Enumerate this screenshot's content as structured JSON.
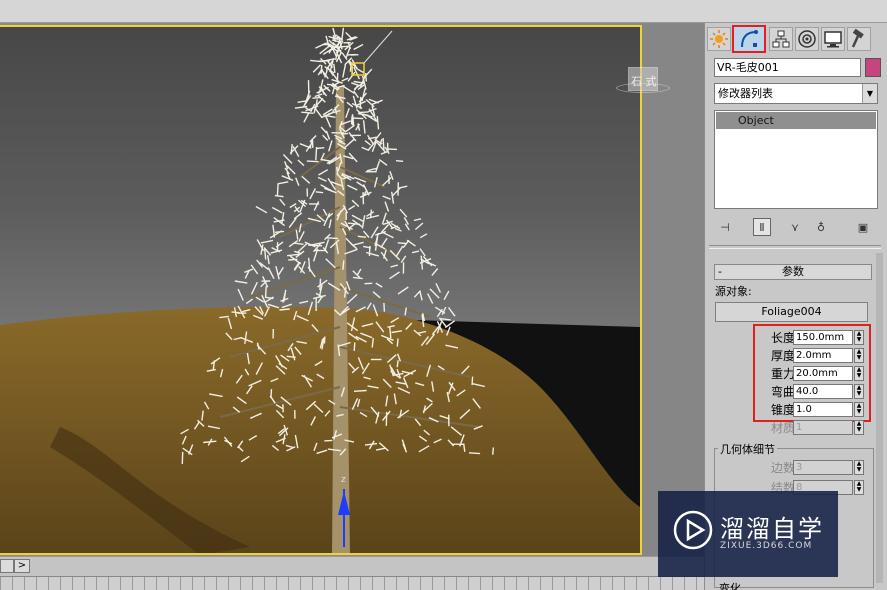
{
  "viewport": {
    "label": "石 式"
  },
  "panel": {
    "tabs": [
      {
        "name": "create-tab",
        "icon": "sun-icon"
      },
      {
        "name": "modify-tab",
        "icon": "modify-curve-icon",
        "active": true
      },
      {
        "name": "hierarchy-tab",
        "icon": "hierarchy-icon"
      },
      {
        "name": "motion-tab",
        "icon": "motion-icon"
      },
      {
        "name": "display-tab",
        "icon": "display-icon"
      },
      {
        "name": "utilities-tab",
        "icon": "hammer-icon"
      }
    ],
    "object_name": "VR-毛皮001",
    "object_color": "#c7457f",
    "modifier_list": "修改器列表",
    "stack_item": "Object"
  },
  "params": {
    "rollout_title": "参数",
    "rollout_minus": "-",
    "source_label": "源对象:",
    "source_object": "Foliage004",
    "rows": [
      {
        "label": "长度",
        "value": "150.0mm"
      },
      {
        "label": "厚度",
        "value": "2.0mm"
      },
      {
        "label": "重力",
        "value": "20.0mm"
      },
      {
        "label": "弯曲",
        "value": "40.0"
      },
      {
        "label": "锥度",
        "value": "1.0"
      },
      {
        "label": "材质",
        "value": "1"
      }
    ],
    "geometry_title": "几何体细节",
    "geo_rows": [
      {
        "label": "边数",
        "value": "3"
      },
      {
        "label": "结数",
        "value": "8"
      }
    ],
    "bottom_label": "变化"
  },
  "timeline": {
    "next_label": ">"
  },
  "watermark": {
    "name": "溜溜自学",
    "url": "ZIXUE.3D66.COM"
  },
  "colors": {
    "viewport_border": "#f1d234",
    "highlight": "#e02020",
    "stack_selected": "#8f8f8f"
  }
}
